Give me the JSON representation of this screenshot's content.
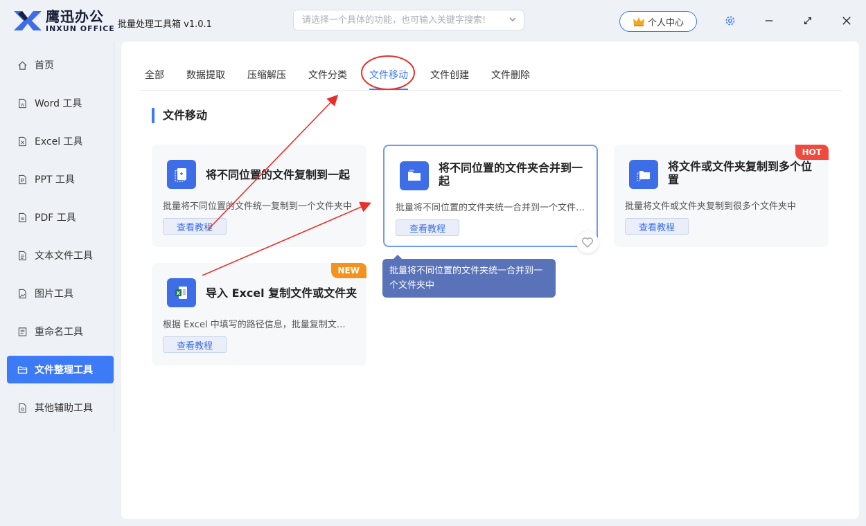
{
  "app": {
    "logo_cn": "鹰迅办公",
    "logo_en": "INXUN OFFICE",
    "title": "批量处理工具箱 v1.0.1",
    "search_placeholder": "请选择一个具体的功能，也可输入关键字搜索!",
    "user_center": "个人中心"
  },
  "sidebar": {
    "items": [
      {
        "label": "首页",
        "icon": "home-icon"
      },
      {
        "label": "Word 工具",
        "icon": "word-file-icon"
      },
      {
        "label": "Excel 工具",
        "icon": "excel-file-icon"
      },
      {
        "label": "PPT 工具",
        "icon": "ppt-file-icon"
      },
      {
        "label": "PDF 工具",
        "icon": "pdf-file-icon"
      },
      {
        "label": "文本文件工具",
        "icon": "text-file-icon"
      },
      {
        "label": "图片工具",
        "icon": "image-file-icon"
      },
      {
        "label": "重命名工具",
        "icon": "rename-icon"
      },
      {
        "label": "文件整理工具",
        "icon": "folder-icon",
        "active": true
      },
      {
        "label": "其他辅助工具",
        "icon": "tools-icon"
      }
    ]
  },
  "tabs": [
    {
      "label": "全部"
    },
    {
      "label": "数据提取"
    },
    {
      "label": "压缩解压"
    },
    {
      "label": "文件分类"
    },
    {
      "label": "文件移动",
      "active": true
    },
    {
      "label": "文件创建"
    },
    {
      "label": "文件删除"
    }
  ],
  "section_title": "文件移动",
  "cards": [
    {
      "title": "将不同位置的文件复制到一起",
      "desc": "批量将不同位置的文件统一复制到一个文件夹中",
      "button": "查看教程",
      "icon": "file-copy-icon"
    },
    {
      "title": "将不同位置的文件夹合并到一起",
      "desc": "批量将不同位置的文件夹统一合并到一个文件夹中",
      "button": "查看教程",
      "icon": "folder-merge-icon"
    },
    {
      "title": "将文件或文件夹复制到多个位置",
      "desc": "批量将文件或文件夹复制到很多个文件夹中",
      "button": "查看教程",
      "icon": "folder-copy-icon",
      "badge": "HOT"
    },
    {
      "title": "导入 Excel 复制文件或文件夹",
      "desc": "根据 Excel 中填写的路径信息，批量复制文件或文件夹",
      "button": "查看教程",
      "icon": "excel-import-icon",
      "badge": "NEW"
    }
  ],
  "tooltip": "批量将不同位置的文件夹统一合并到一个文件夹中",
  "colors": {
    "accent": "#3d7af5",
    "hot": "#ef4a3e",
    "new": "#f5921e",
    "annotation": "#e8302a",
    "tooltip": "#5a73b8"
  }
}
